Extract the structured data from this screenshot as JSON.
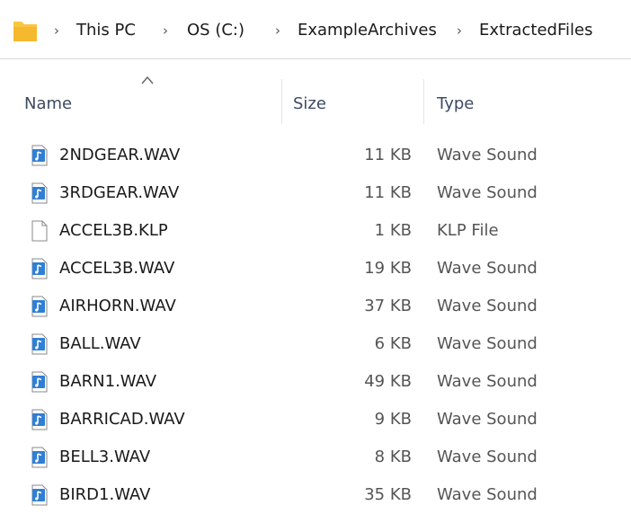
{
  "breadcrumb": {
    "items": [
      "This PC",
      "OS (C:)",
      "ExampleArchives",
      "ExtractedFiles"
    ]
  },
  "columns": {
    "name": "Name",
    "size": "Size",
    "type": "Type",
    "sort_indicator": "sort-ascending"
  },
  "files": [
    {
      "name": "2NDGEAR.WAV",
      "size": "11 KB",
      "type": "Wave Sound",
      "icon": "audio-file-icon"
    },
    {
      "name": "3RDGEAR.WAV",
      "size": "11 KB",
      "type": "Wave Sound",
      "icon": "audio-file-icon"
    },
    {
      "name": "ACCEL3B.KLP",
      "size": "1 KB",
      "type": "KLP File",
      "icon": "generic-file-icon"
    },
    {
      "name": "ACCEL3B.WAV",
      "size": "19 KB",
      "type": "Wave Sound",
      "icon": "audio-file-icon"
    },
    {
      "name": "AIRHORN.WAV",
      "size": "37 KB",
      "type": "Wave Sound",
      "icon": "audio-file-icon"
    },
    {
      "name": "BALL.WAV",
      "size": "6 KB",
      "type": "Wave Sound",
      "icon": "audio-file-icon"
    },
    {
      "name": "BARN1.WAV",
      "size": "49 KB",
      "type": "Wave Sound",
      "icon": "audio-file-icon"
    },
    {
      "name": "BARRICAD.WAV",
      "size": "9 KB",
      "type": "Wave Sound",
      "icon": "audio-file-icon"
    },
    {
      "name": "BELL3.WAV",
      "size": "8 KB",
      "type": "Wave Sound",
      "icon": "audio-file-icon"
    },
    {
      "name": "BIRD1.WAV",
      "size": "35 KB",
      "type": "Wave Sound",
      "icon": "audio-file-icon"
    }
  ],
  "colors": {
    "folder": "#f8c741",
    "audio_icon": "#2f7fd6",
    "header_text": "#3c4a64"
  }
}
